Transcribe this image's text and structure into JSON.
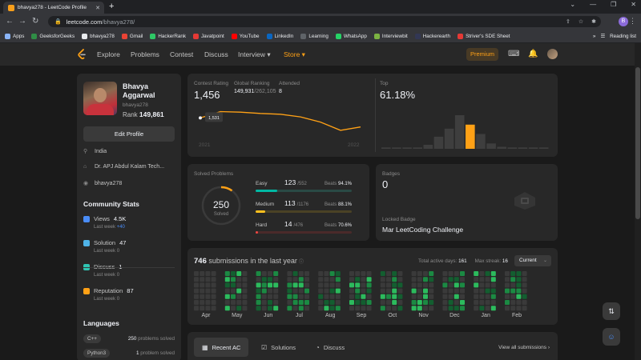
{
  "browser": {
    "tab_title": "bhavya278 - LeetCode Profile",
    "url_host": "leetcode.com",
    "url_path": "/bhavya278/",
    "bookmarks": [
      {
        "label": "Apps",
        "color": "#8ab4f8"
      },
      {
        "label": "GeeksforGeeks",
        "color": "#2f8d46"
      },
      {
        "label": "bhavya278",
        "color": "#e8eaed"
      },
      {
        "label": "Gmail",
        "color": "#ea4335"
      },
      {
        "label": "HackerRank",
        "color": "#2ec866"
      },
      {
        "label": "Javatpoint",
        "color": "#e53935"
      },
      {
        "label": "YouTube",
        "color": "#ff0000"
      },
      {
        "label": "LinkedIn",
        "color": "#0a66c2"
      },
      {
        "label": "Learning",
        "color": "#5f6368"
      },
      {
        "label": "WhatsApp",
        "color": "#25d366"
      },
      {
        "label": "Interviewbit",
        "color": "#7cb342"
      },
      {
        "label": "Hackerearth",
        "color": "#323754"
      },
      {
        "label": "Striver's SDE Sheet",
        "color": "#e53935"
      }
    ],
    "reading_list": "Reading list",
    "profile_initial": "B"
  },
  "nav": {
    "explore": "Explore",
    "problems": "Problems",
    "contest": "Contest",
    "discuss": "Discuss",
    "interview": "Interview ▾",
    "store": "Store ▾",
    "premium": "Premium"
  },
  "profile": {
    "name": "Bhavya Aggarwal",
    "handle": "bhavya278",
    "rank_label": "Rank",
    "rank": "149,861",
    "edit": "Edit Profile",
    "country": "India",
    "school": "Dr. APJ Abdul Kalam Tech...",
    "github": "bhavya278"
  },
  "community": {
    "title": "Community Stats",
    "items": [
      {
        "label": "Views",
        "value": "4.5K",
        "week": "Last week",
        "delta": "+40",
        "color": "#4a8df7"
      },
      {
        "label": "Solution",
        "value": "47",
        "week": "Last week",
        "delta": "0",
        "color": "#4fb3e8"
      },
      {
        "label": "Discuss",
        "value": "1",
        "week": "Last week",
        "delta": "0",
        "color": "#2fc4b2"
      },
      {
        "label": "Reputation",
        "value": "87",
        "week": "Last week",
        "delta": "0",
        "color": "#ffa116"
      }
    ]
  },
  "languages": {
    "title": "Languages",
    "items": [
      {
        "name": "C++",
        "count": "250",
        "suffix": "problems solved"
      },
      {
        "name": "Python3",
        "count": "1",
        "suffix": "problem solved"
      }
    ]
  },
  "contest": {
    "rating_label": "Contest Rating",
    "rating": "1,456",
    "ranking_label": "Global Ranking",
    "ranking": "149,931",
    "ranking_total": "/262,105",
    "attended_label": "Attended",
    "attended": "8",
    "start_year": "2021",
    "end_year": "2022",
    "tooltip": "1,531",
    "top_label": "Top",
    "top": "61.18%"
  },
  "solved": {
    "title": "Solved Problems",
    "total": "250",
    "total_label": "Solved",
    "total_fraction": 0.1,
    "difficulties": [
      {
        "name": "Easy",
        "solved": "123",
        "total": "/552",
        "beats_label": "Beats",
        "beats": "94.1%",
        "fraction": 0.223,
        "color": "#00b8a3",
        "track": "#2a4a45"
      },
      {
        "name": "Medium",
        "solved": "113",
        "total": "/1176",
        "beats_label": "Beats",
        "beats": "88.1%",
        "fraction": 0.096,
        "color": "#ffc01e",
        "track": "#4a4225"
      },
      {
        "name": "Hard",
        "solved": "14",
        "total": "/476",
        "beats_label": "Beats",
        "beats": "70.6%",
        "fraction": 0.029,
        "color": "#ef4743",
        "track": "#4a2a2a"
      }
    ]
  },
  "badges": {
    "label": "Badges",
    "count": "0",
    "locked_label": "Locked Badge",
    "locked_name": "Mar LeetCoding Challenge"
  },
  "submissions": {
    "count": "746",
    "title_suffix": "submissions in the last year",
    "active_label": "Total active days:",
    "active": "161",
    "streak_label": "Max streak:",
    "streak": "16",
    "select": "Current",
    "months": [
      "Apr",
      "May",
      "Jun",
      "Jul",
      "Aug",
      "Sep",
      "Oct",
      "Nov",
      "Dec",
      "Jan",
      "Feb"
    ]
  },
  "tabs": {
    "recent": "Recent AC",
    "solutions": "Solutions",
    "discuss": "Discuss",
    "view_all": "View all submissions ›"
  },
  "chart_data": [
    {
      "type": "line",
      "title": "Contest Rating",
      "x": [
        "2021",
        "",
        "",
        "",
        "",
        "",
        "",
        "",
        "2022"
      ],
      "series": [
        {
          "values": [
            1500,
            1531,
            1528,
            1522,
            1518,
            1505,
            1480,
            1440,
            1456
          ]
        }
      ]
    },
    {
      "type": "bar",
      "title": "Top",
      "values": [
        2,
        2,
        2,
        2,
        6,
        18,
        30,
        50,
        36,
        22,
        8,
        3,
        2,
        2,
        2,
        2
      ],
      "highlight_index": 8
    }
  ]
}
